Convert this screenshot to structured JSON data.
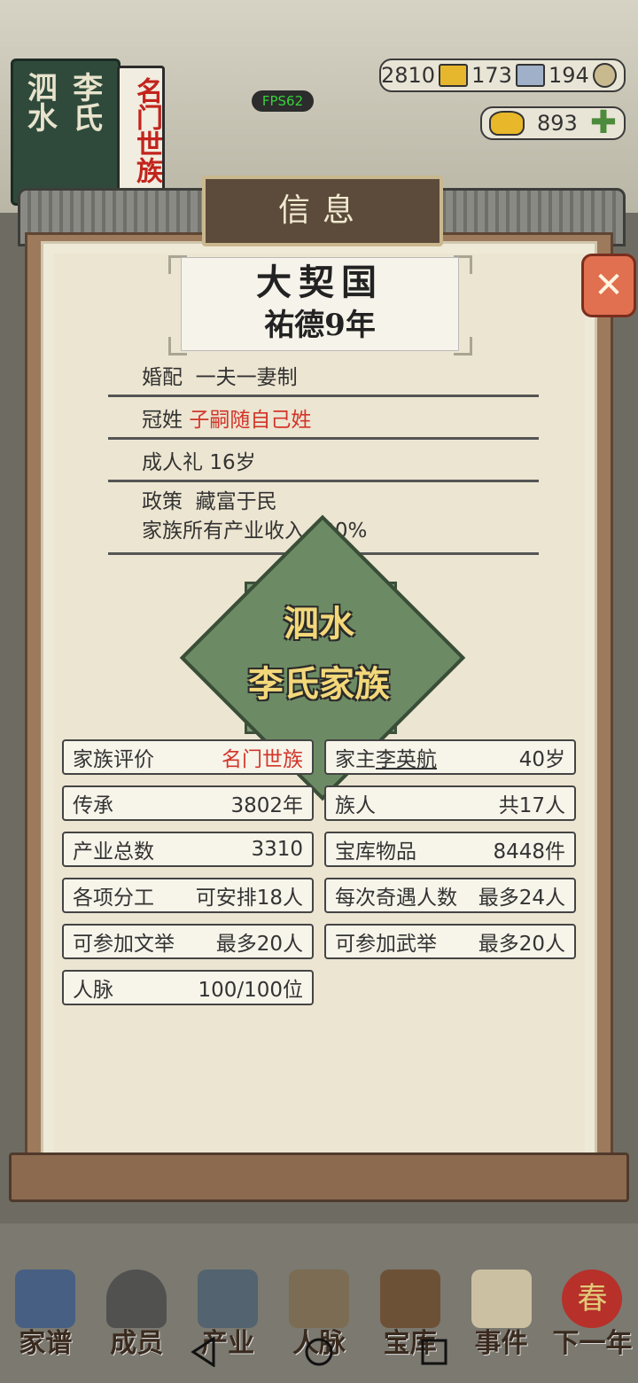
{
  "hud": {
    "fps": "FPS62",
    "res1": "2810",
    "res2": "173",
    "res3": "194",
    "gold": "893"
  },
  "family_sign": {
    "col1": "泗水",
    "col2": "李氏",
    "rank": "名门世族"
  },
  "dialog": {
    "title": "信息",
    "country": "大契国",
    "era_year": "祐德9年",
    "marriage_label": "婚配",
    "marriage_value": "一夫一妻制",
    "surname_label": "冠姓",
    "surname_value": "子嗣随自己姓",
    "coming_of_age_label": "成人礼",
    "coming_of_age_value": "16岁",
    "policy_label": "政策",
    "policy_value": "藏富于民",
    "policy_effect": "家族所有产业收入+20%",
    "emblem_line1": "泗水",
    "emblem_line2": "李氏家族"
  },
  "stats": {
    "reputation_label": "家族评价",
    "reputation_value": "名门世族",
    "head_label": "家主",
    "head_name": "李英航",
    "head_age": "40岁",
    "heritage_label": "传承",
    "heritage_value": "3802年",
    "members_label": "族人",
    "members_value": "共17人",
    "industry_label": "产业总数",
    "industry_value": "3310",
    "treasury_label": "宝库物品",
    "treasury_value": "8448件",
    "work_label": "各项分工",
    "work_value": "可安排18人",
    "encounter_label": "每次奇遇人数",
    "encounter_value": "最多24人",
    "civil_exam_label": "可参加文举",
    "civil_exam_value": "最多20人",
    "military_exam_label": "可参加武举",
    "military_exam_value": "最多20人",
    "network_label": "人脉",
    "network_value": "100/100位"
  },
  "nav": {
    "genealogy": "家谱",
    "members": "成员",
    "industry": "产业",
    "people": "人脉",
    "treasury": "宝库",
    "event": "事件",
    "next_year": "下一年",
    "spring_badge": "春"
  },
  "colors": {
    "accent_red": "#d2352a",
    "paper": "#efe9d7",
    "frame": "#9d7a5c",
    "emblem_green": "#6c8b65"
  }
}
